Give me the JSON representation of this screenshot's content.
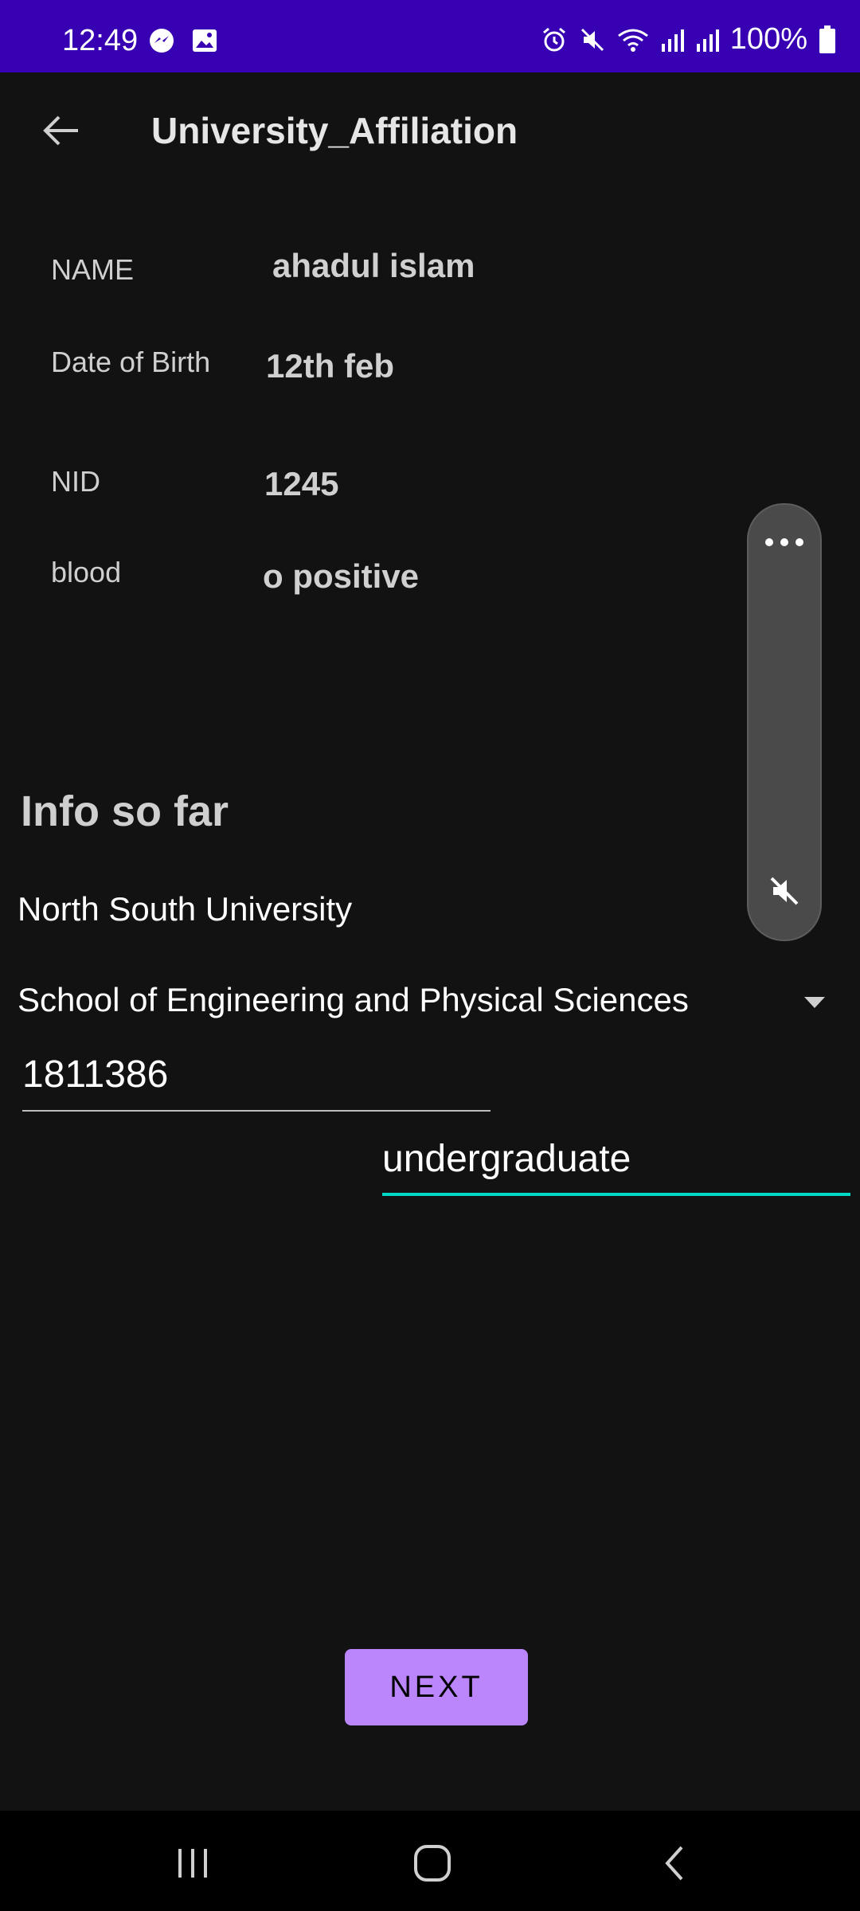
{
  "status_bar": {
    "time": "12:49",
    "battery_text": "100%",
    "left_icons": [
      "messenger-icon",
      "image-icon"
    ],
    "right_icons": [
      "alarm-icon",
      "mute-icon",
      "wifi-icon",
      "signal-icon",
      "signal-icon",
      "battery-icon"
    ],
    "background": "#3700b3"
  },
  "app_bar": {
    "title": "University_Affiliation"
  },
  "info": {
    "rows": [
      {
        "label": "NAME",
        "value": "ahadul islam"
      },
      {
        "label": "Date of Birth",
        "value": "12th feb"
      },
      {
        "label": "NID",
        "value": "1245"
      },
      {
        "label": "blood",
        "value": "o positive"
      }
    ]
  },
  "section": {
    "title": "Info so far"
  },
  "university": "North South University",
  "school": {
    "selected": "School of Engineering and Physical Sciences"
  },
  "student_id": {
    "value": "1811386"
  },
  "level": {
    "value": "undergraduate",
    "accent": "#03dac5"
  },
  "next_button": {
    "label": "NEXT",
    "color": "#bb86fc"
  }
}
